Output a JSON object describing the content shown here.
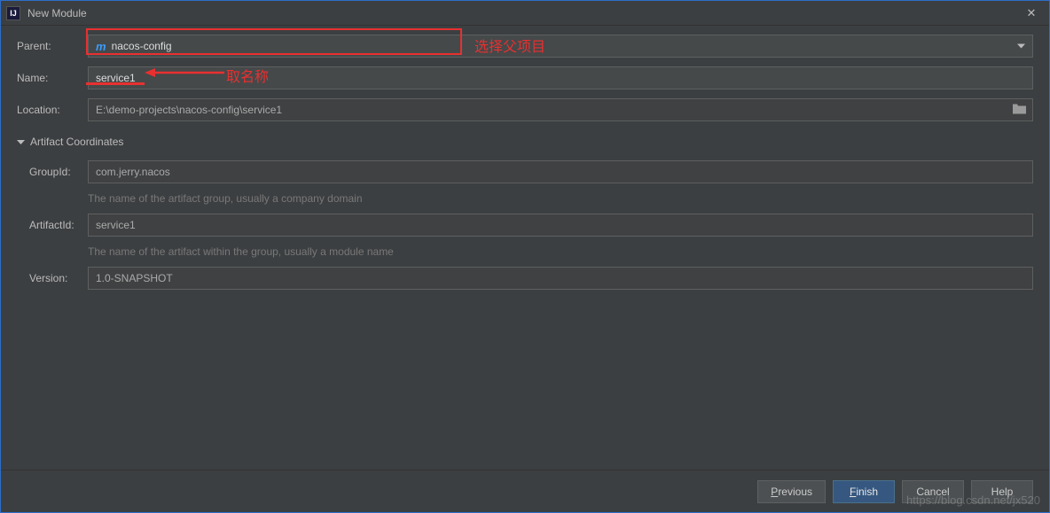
{
  "window": {
    "title": "New Module"
  },
  "form": {
    "parent_label": "Parent:",
    "parent_value": "nacos-config",
    "name_label": "Name:",
    "name_value": "service1",
    "location_label": "Location:",
    "location_value": "E:\\demo-projects\\nacos-config\\service1"
  },
  "section": {
    "title": "Artifact Coordinates"
  },
  "artifact": {
    "group_label": "GroupId:",
    "group_value": "com.jerry.nacos",
    "group_hint": "The name of the artifact group, usually a company domain",
    "artifact_label": "ArtifactId:",
    "artifact_value": "service1",
    "artifact_hint": "The name of the artifact within the group, usually a module name",
    "version_label": "Version:",
    "version_value": "1.0-SNAPSHOT"
  },
  "buttons": {
    "previous": "Previous",
    "finish": "Finish",
    "cancel": "Cancel",
    "help": "Help"
  },
  "annotations": {
    "select_parent": "选择父项目",
    "name_hint": "取名称"
  },
  "watermark": "https://blog.csdn.net/jx520"
}
